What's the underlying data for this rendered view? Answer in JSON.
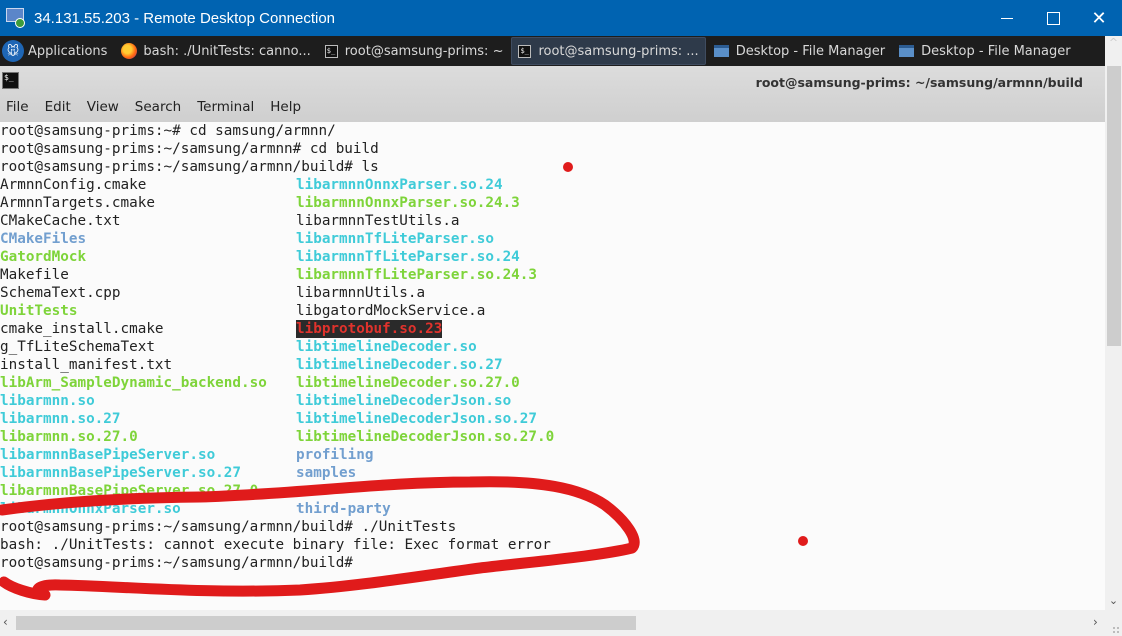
{
  "window": {
    "title": "34.131.55.203 - Remote Desktop Connection",
    "controls": [
      "minimize",
      "maximize",
      "close"
    ]
  },
  "taskbar": {
    "applications_label": "Applications",
    "tasks": [
      {
        "icon": "firefox-icon",
        "label": "bash: ./UnitTests: canno...",
        "active": false
      },
      {
        "icon": "terminal-icon",
        "label": "root@samsung-prims: ~",
        "active": false
      },
      {
        "icon": "terminal-icon",
        "label": "root@samsung-prims: ...",
        "active": true
      },
      {
        "icon": "file-manager-icon",
        "label": "Desktop - File Manager",
        "active": false
      },
      {
        "icon": "file-manager-icon",
        "label": "Desktop - File Manager",
        "active": false
      }
    ]
  },
  "terminal_window": {
    "title": "root@samsung-prims: ~/samsung/armnn/build",
    "menu": [
      "File",
      "Edit",
      "View",
      "Search",
      "Terminal",
      "Help"
    ]
  },
  "terminal": {
    "commands": [
      "root@samsung-prims:~# cd samsung/armnn/",
      "root@samsung-prims:~/samsung/armnn# cd build",
      "root@samsung-prims:~/samsung/armnn/build# ls"
    ],
    "ls_rows": [
      [
        {
          "t": "ArmnnConfig.cmake",
          "c": "plain"
        },
        {
          "t": "libarmnnOnnxParser.so.24",
          "c": "cyan"
        }
      ],
      [
        {
          "t": "ArmnnTargets.cmake",
          "c": "plain"
        },
        {
          "t": "libarmnnOnnxParser.so.24.3",
          "c": "green"
        }
      ],
      [
        {
          "t": "CMakeCache.txt",
          "c": "plain"
        },
        {
          "t": "libarmnnTestUtils.a",
          "c": "plain"
        }
      ],
      [
        {
          "t": "CMakeFiles",
          "c": "blue"
        },
        {
          "t": "libarmnnTfLiteParser.so",
          "c": "cyan"
        }
      ],
      [
        {
          "t": "GatordMock",
          "c": "green"
        },
        {
          "t": "libarmnnTfLiteParser.so.24",
          "c": "cyan"
        }
      ],
      [
        {
          "t": "Makefile",
          "c": "plain"
        },
        {
          "t": "libarmnnTfLiteParser.so.24.3",
          "c": "green"
        }
      ],
      [
        {
          "t": "SchemaText.cpp",
          "c": "plain"
        },
        {
          "t": "libarmnnUtils.a",
          "c": "plain"
        }
      ],
      [
        {
          "t": "UnitTests",
          "c": "green"
        },
        {
          "t": "libgatordMockService.a",
          "c": "plain"
        }
      ],
      [
        {
          "t": "cmake_install.cmake",
          "c": "plain"
        },
        {
          "t": "libprotobuf.so.23",
          "c": "broken"
        }
      ],
      [
        {
          "t": "g_TfLiteSchemaText",
          "c": "plain"
        },
        {
          "t": "libtimelineDecoder.so",
          "c": "cyan"
        }
      ],
      [
        {
          "t": "install_manifest.txt",
          "c": "plain"
        },
        {
          "t": "libtimelineDecoder.so.27",
          "c": "cyan"
        }
      ],
      [
        {
          "t": "libArm_SampleDynamic_backend.so",
          "c": "green"
        },
        {
          "t": "libtimelineDecoder.so.27.0",
          "c": "green"
        }
      ],
      [
        {
          "t": "libarmnn.so",
          "c": "cyan"
        },
        {
          "t": "libtimelineDecoderJson.so",
          "c": "cyan"
        }
      ],
      [
        {
          "t": "libarmnn.so.27",
          "c": "cyan"
        },
        {
          "t": "libtimelineDecoderJson.so.27",
          "c": "cyan"
        }
      ],
      [
        {
          "t": "libarmnn.so.27.0",
          "c": "green"
        },
        {
          "t": "libtimelineDecoderJson.so.27.0",
          "c": "green"
        }
      ],
      [
        {
          "t": "libarmnnBasePipeServer.so",
          "c": "cyan"
        },
        {
          "t": "profiling",
          "c": "blue"
        }
      ],
      [
        {
          "t": "libarmnnBasePipeServer.so.27",
          "c": "cyan"
        },
        {
          "t": "samples",
          "c": "blue"
        }
      ],
      [
        {
          "t": "libarmnnBasePipeServer.so.27.0",
          "c": "green"
        },
        {
          "t": "",
          "c": "plain"
        }
      ],
      [
        {
          "t": "libarmnnOnnxParser.so",
          "c": "cyan"
        },
        {
          "t": "third-party",
          "c": "blue"
        }
      ]
    ],
    "after": [
      "root@samsung-prims:~/samsung/armnn/build# ./UnitTests",
      "bash: ./UnitTests: cannot execute binary file: Exec format error",
      "root@samsung-prims:~/samsung/armnn/build#"
    ]
  },
  "colors": {
    "titlebar": "#0063b1",
    "annotation": "#e01b1b",
    "ls_cyan": "#3fcbd8",
    "ls_green": "#7ed43a",
    "ls_blue": "#729fcf",
    "ls_broken": "#e0322c"
  }
}
